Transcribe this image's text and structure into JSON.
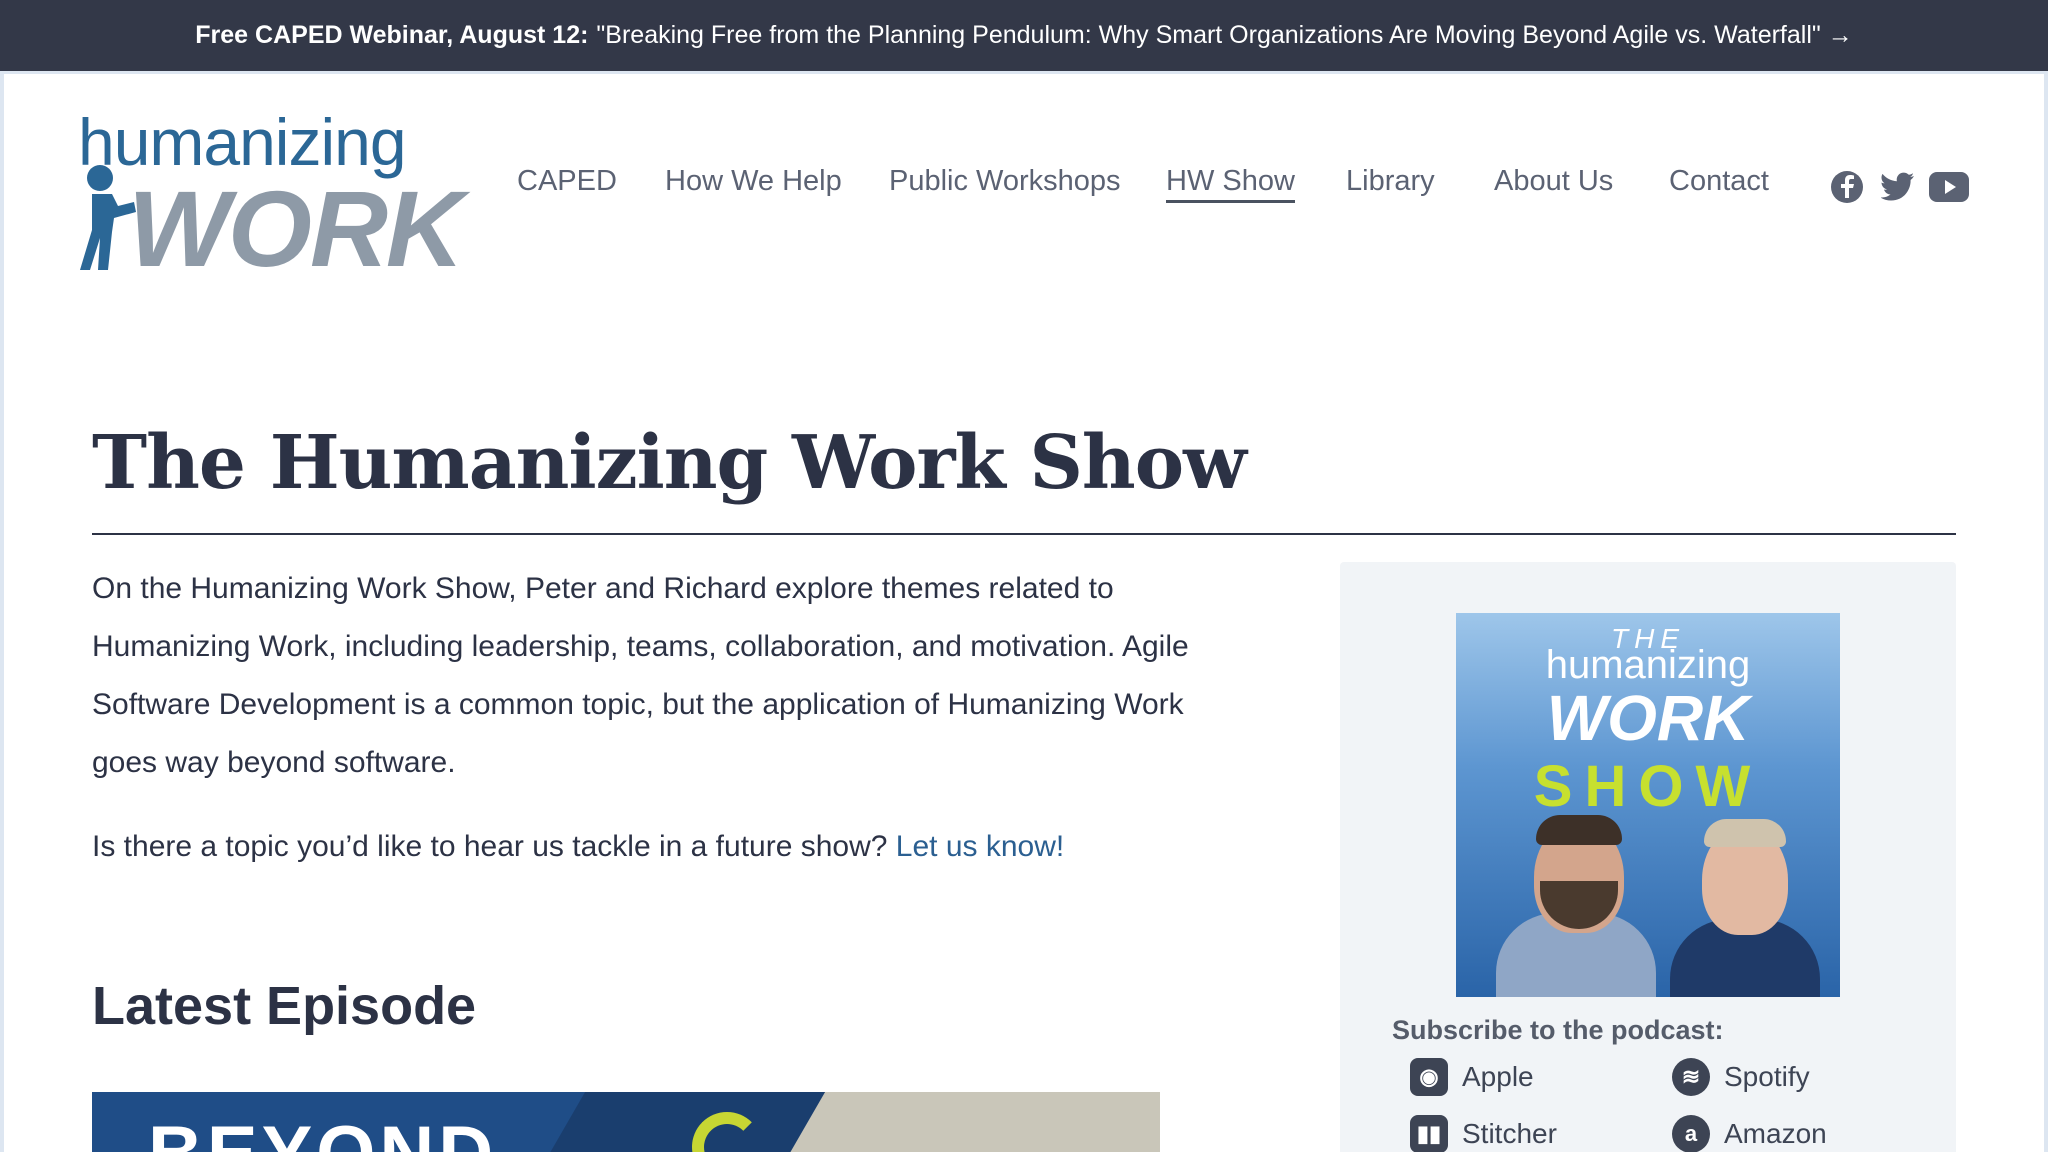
{
  "banner": {
    "bold": "Free CAPED Webinar, August 12:",
    "text": "\"Breaking Free from the Planning Pendulum: Why Smart Organizations Are Moving Beyond Agile vs. Waterfall\" →"
  },
  "logo": {
    "top": "humanizing",
    "bottom": "WORK"
  },
  "nav": {
    "items": [
      {
        "label": "CAPED"
      },
      {
        "label": "How We Help"
      },
      {
        "label": "Public Workshops"
      },
      {
        "label": "HW Show",
        "active": true
      },
      {
        "label": "Library"
      },
      {
        "label": "About Us"
      },
      {
        "label": "Contact"
      }
    ],
    "social": [
      "facebook-icon",
      "twitter-icon",
      "youtube-icon"
    ]
  },
  "page": {
    "title": "The Humanizing Work Show",
    "intro": "On the Humanizing Work Show, Peter and Richard explore themes related to Humanizing Work, including leadership, teams, collaboration, and motivation. Agile Software Development is a common topic, but the application of Humanizing Work goes way beyond software.",
    "topic_text": "Is there a topic you’d like to hear us tackle in a future show?",
    "topic_link": "Let us know!",
    "latest_heading": "Latest Episode",
    "episode_thumb_text": "BEYOND"
  },
  "sidebar": {
    "cover": {
      "the": "THE",
      "humanizing": "humanizing",
      "work": "WORK",
      "show": "SHOW"
    },
    "subscribe_title": "Subscribe to the podcast:",
    "platforms": [
      {
        "label": "Apple",
        "icon": "apple-podcasts-icon"
      },
      {
        "label": "Spotify",
        "icon": "spotify-icon"
      },
      {
        "label": "Stitcher",
        "icon": "stitcher-icon"
      },
      {
        "label": "Amazon",
        "icon": "amazon-icon"
      }
    ]
  },
  "colors": {
    "banner_bg": "#333848",
    "heading": "#2c3245",
    "link": "#2b5f91",
    "logo_blue": "#2b6796",
    "logo_grey": "#8e9aa7",
    "show_green": "#c7e02f"
  }
}
